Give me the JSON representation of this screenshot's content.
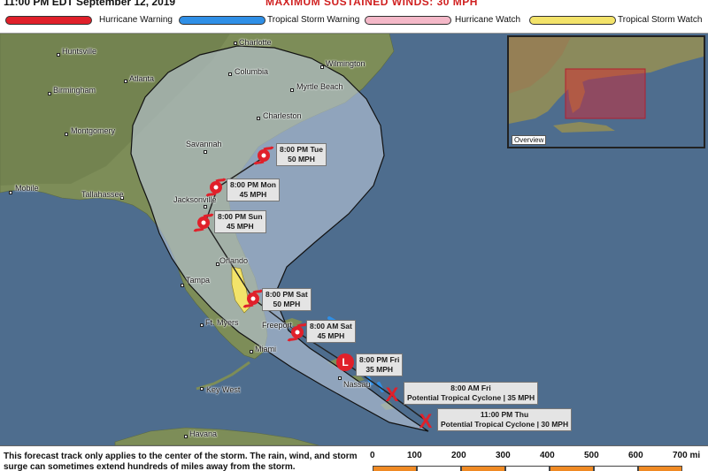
{
  "header": {
    "issued": "11:00 PM EDT September 12, 2019",
    "partial_text": "MAXIMUM SUSTAINED WINDS: 30 MPH"
  },
  "legend": [
    {
      "label": "Hurricane Warning",
      "color": "#e0202a"
    },
    {
      "label": "Tropical Storm Warning",
      "color": "#2f8fe6"
    },
    {
      "label": "Hurricane Watch",
      "color": "#f4b8c8"
    },
    {
      "label": "Tropical Storm Watch",
      "color": "#f3e36a"
    }
  ],
  "cities": [
    {
      "name": "Charlotte"
    },
    {
      "name": "Huntsville"
    },
    {
      "name": "Wilmington"
    },
    {
      "name": "Columbia"
    },
    {
      "name": "Atlanta"
    },
    {
      "name": "Myrtle Beach"
    },
    {
      "name": "Birmingham"
    },
    {
      "name": "Charleston"
    },
    {
      "name": "Montgomery"
    },
    {
      "name": "Savannah"
    },
    {
      "name": "Mobile"
    },
    {
      "name": "Tallahassee"
    },
    {
      "name": "Jacksonville"
    },
    {
      "name": "Orlando"
    },
    {
      "name": "Tampa"
    },
    {
      "name": "Freeport"
    },
    {
      "name": "Ft. Myers"
    },
    {
      "name": "Miami"
    },
    {
      "name": "Nassau"
    },
    {
      "name": "Key West"
    },
    {
      "name": "Havana"
    }
  ],
  "forecast_points": [
    {
      "time": "8:00 PM Tue",
      "detail": "50 MPH",
      "symbol": "hurricane-icon"
    },
    {
      "time": "8:00 PM Mon",
      "detail": "45 MPH",
      "symbol": "hurricane-icon"
    },
    {
      "time": "8:00 PM Sun",
      "detail": "45 MPH",
      "symbol": "hurricane-icon"
    },
    {
      "time": "8:00 PM Sat",
      "detail": "50 MPH",
      "symbol": "hurricane-icon"
    },
    {
      "time": "8:00 AM Sat",
      "detail": "45 MPH",
      "symbol": "hurricane-icon"
    },
    {
      "time": "8:00 PM Fri",
      "detail": "35 MPH",
      "symbol": "low-pressure-icon",
      "letter": "L"
    },
    {
      "time": "8:00 AM Fri",
      "detail": "Potential Tropical Cyclone  |  35 MPH",
      "symbol": "x-icon",
      "letter": "X"
    },
    {
      "time": "11:00 PM Thu",
      "detail": "Potential Tropical Cyclone  |  30 MPH",
      "symbol": "x-icon",
      "letter": "X"
    }
  ],
  "inset": {
    "label": "Overview"
  },
  "footer": {
    "disclaimer": "This forecast track only applies to the center of the storm. The rain, wind, and storm surge can sometimes extend hundreds of miles away from the storm.",
    "scale_ticks": [
      "0",
      "100",
      "200",
      "300",
      "400",
      "500",
      "600",
      "700 mi"
    ],
    "scale_colors": [
      "#f08a24",
      "#ffffff"
    ]
  },
  "colors": {
    "ocean": "#4e6d8e",
    "land": "#7c8c57",
    "cone": "#b9c6d9",
    "track": "#222222",
    "storm_red": "#e0202a"
  }
}
